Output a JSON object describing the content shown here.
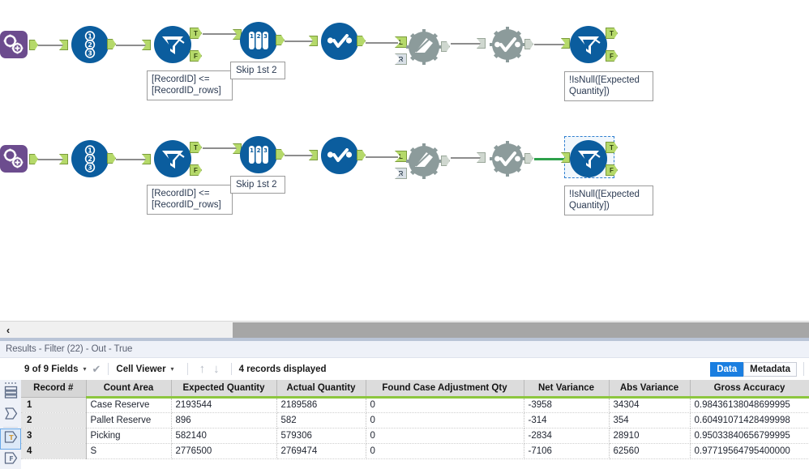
{
  "canvas": {
    "rows": [
      {
        "id": "workflow-row-1",
        "tools": [
          {
            "name": "macro-tool",
            "kind": "macro",
            "icon": "gears-icon"
          },
          {
            "name": "record-id-tool",
            "kind": "circle",
            "icon": "record-id-123-icon"
          },
          {
            "name": "filter-tool",
            "kind": "circle",
            "icon": "filter-funnel-icon",
            "out_true": "T",
            "out_false": "F"
          },
          {
            "name": "sample-tool",
            "kind": "circle",
            "icon": "sample-testtubes-icon"
          },
          {
            "name": "formula-tool",
            "kind": "circle",
            "icon": "formula-check-icon"
          },
          {
            "name": "join-tool-disabled",
            "kind": "gear",
            "icon": "join-icon",
            "in_left": "L",
            "in_right": "R"
          },
          {
            "name": "formula-tool-disabled",
            "kind": "gear",
            "icon": "formula-check-icon"
          },
          {
            "name": "filter-tool-2",
            "kind": "circle",
            "icon": "filter-funnel-icon",
            "out_true": "T",
            "out_false": "F"
          }
        ],
        "annotations": [
          {
            "name": "filter-annotation",
            "text": "[RecordID] <=\n[RecordID_rows]"
          },
          {
            "name": "sample-annotation",
            "text": "Skip 1st 2"
          },
          {
            "name": "filter2-annotation",
            "text": "!IsNull([Expected\nQuantity])"
          }
        ]
      },
      {
        "id": "workflow-row-2",
        "selected_tool": "filter-tool-2",
        "tools": [
          {
            "name": "macro-tool",
            "kind": "macro",
            "icon": "gears-icon"
          },
          {
            "name": "record-id-tool",
            "kind": "circle",
            "icon": "record-id-123-icon"
          },
          {
            "name": "filter-tool",
            "kind": "circle",
            "icon": "filter-funnel-icon",
            "out_true": "T",
            "out_false": "F"
          },
          {
            "name": "sample-tool",
            "kind": "circle",
            "icon": "sample-testtubes-icon"
          },
          {
            "name": "formula-tool",
            "kind": "circle",
            "icon": "formula-check-icon"
          },
          {
            "name": "join-tool-disabled",
            "kind": "gear",
            "icon": "join-icon",
            "in_left": "L",
            "in_right": "R"
          },
          {
            "name": "formula-tool-disabled",
            "kind": "gear",
            "icon": "formula-check-icon"
          },
          {
            "name": "filter-tool-2",
            "kind": "circle",
            "icon": "filter-funnel-icon",
            "out_true": "T",
            "out_false": "F"
          }
        ],
        "annotations": [
          {
            "name": "filter-annotation",
            "text": "[RecordID] <=\n[RecordID_rows]"
          },
          {
            "name": "sample-annotation",
            "text": "Skip 1st 2"
          },
          {
            "name": "filter2-annotation",
            "text": "!IsNull([Expected\nQuantity])"
          }
        ]
      }
    ],
    "labels": {
      "true": "T",
      "false": "F",
      "left": "L",
      "right": "R"
    },
    "colors": {
      "tool_blue": "#0b5d9e",
      "tool_gray": "#8c9b9b",
      "macro_purple": "#6c4c8e",
      "anchor_green": "#b5d96a",
      "selected_wire": "#2ea14b",
      "selection_outline": "#2f7fd0"
    }
  },
  "scrollbar": {
    "left_arrow": "‹"
  },
  "results": {
    "title": "Results - Filter (22) - Out - True",
    "toolbar": {
      "fields_label": "9 of 9 Fields",
      "fields_caret": "▾",
      "check_icon": "✔",
      "viewer_label": "Cell Viewer",
      "viewer_caret": "▾",
      "up_arrow": "↑",
      "down_arrow": "↓",
      "records_displayed": "4 records displayed",
      "data_tab": "Data",
      "metadata_tab": "Metadata",
      "active_tab": "Data"
    },
    "rail": {
      "items": [
        {
          "name": "rail-grip",
          "icon": "grip-dots-icon"
        },
        {
          "name": "rail-item-records",
          "icon": "list-rows-icon"
        },
        {
          "name": "rail-item-output",
          "icon": "output-anchor-icon"
        },
        {
          "name": "rail-item-true-output",
          "icon": "true-anchor-icon",
          "label": "T",
          "selected": true
        },
        {
          "name": "rail-item-false-output",
          "icon": "false-anchor-icon",
          "label": "F"
        }
      ]
    },
    "grid": {
      "columns": [
        "Record #",
        "Count Area",
        "Expected Quantity",
        "Actual Quantity",
        "Found Case Adjustment Qty",
        "Net Variance",
        "Abs Variance",
        "Gross Accuracy"
      ],
      "rows": [
        [
          "1",
          "Case Reserve",
          "2193544",
          "2189586",
          "0",
          "-3958",
          "34304",
          "0.98436138048699995"
        ],
        [
          "2",
          "Pallet Reserve",
          "896",
          "582",
          "0",
          "-314",
          "354",
          "0.60491071428499998"
        ],
        [
          "3",
          "Picking",
          "582140",
          "579306",
          "0",
          "-2834",
          "28910",
          "0.95033840656799995"
        ],
        [
          "4",
          "S",
          "2776500",
          "2769474",
          "0",
          "-7106",
          "62560",
          "0.97719564795400000"
        ]
      ]
    }
  }
}
